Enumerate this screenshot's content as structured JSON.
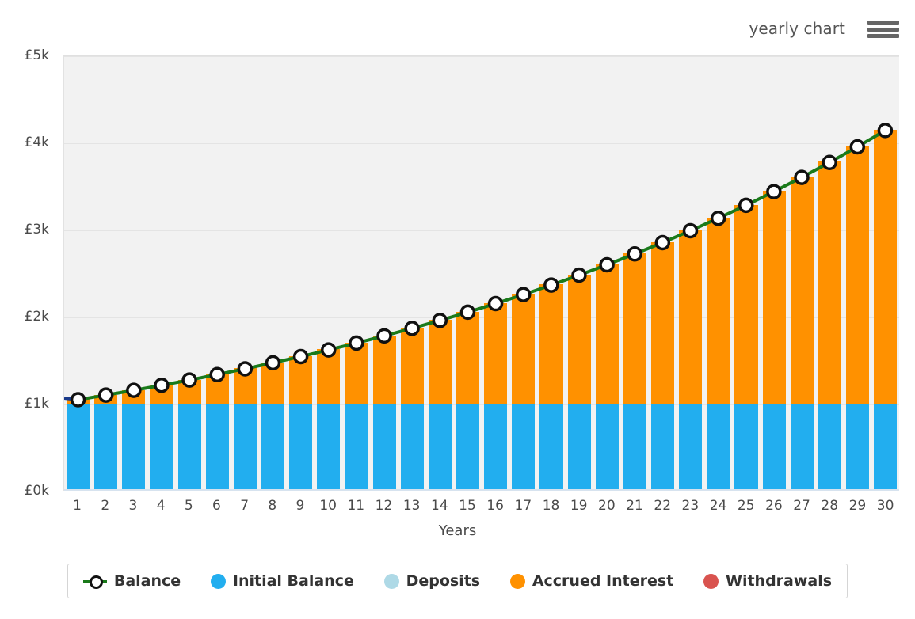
{
  "header": {
    "title": "yearly chart",
    "menu_icon": "hamburger-menu-icon"
  },
  "colors": {
    "initial_balance": "#22aeef",
    "deposits": "#aed9e6",
    "accrued_interest": "#ff9100",
    "withdrawals": "#d9534f",
    "balance_line": "#1a7a1a",
    "plot_background": "#f2f2f2",
    "gridline": "#e4e4e4"
  },
  "legend": {
    "items": [
      {
        "label": "Balance",
        "marker": "line-with-point",
        "color": "#1a7a1a"
      },
      {
        "label": "Initial Balance",
        "marker": "dot",
        "color": "#22aeef"
      },
      {
        "label": "Deposits",
        "marker": "dot",
        "color": "#aed9e6"
      },
      {
        "label": "Accrued Interest",
        "marker": "dot",
        "color": "#ff9100"
      },
      {
        "label": "Withdrawals",
        "marker": "dot",
        "color": "#d9534f"
      }
    ]
  },
  "chart_data": {
    "type": "bar",
    "title": "yearly chart",
    "xlabel": "Years",
    "ylabel": "",
    "ylim": [
      0,
      5000
    ],
    "ytick_labels": [
      "£5k",
      "£4k",
      "£3k",
      "£2k",
      "£1k",
      "£0k"
    ],
    "ytick_values": [
      5000,
      4000,
      3000,
      2000,
      1000,
      0
    ],
    "grid": true,
    "legend_position": "bottom",
    "stacked": true,
    "currency_symbol": "£",
    "categories": [
      1,
      2,
      3,
      4,
      5,
      6,
      7,
      8,
      9,
      10,
      11,
      12,
      13,
      14,
      15,
      16,
      17,
      18,
      19,
      20,
      21,
      22,
      23,
      24,
      25,
      26,
      27,
      28,
      29,
      30
    ],
    "series": [
      {
        "name": "Initial Balance",
        "color": "#22aeef",
        "values": [
          1000,
          1000,
          1000,
          1000,
          1000,
          1000,
          1000,
          1000,
          1000,
          1000,
          1000,
          1000,
          1000,
          1000,
          1000,
          1000,
          1000,
          1000,
          1000,
          1000,
          1000,
          1000,
          1000,
          1000,
          1000,
          1000,
          1000,
          1000,
          1000,
          1000
        ]
      },
      {
        "name": "Deposits",
        "color": "#aed9e6",
        "values": [
          0,
          0,
          0,
          0,
          0,
          0,
          0,
          0,
          0,
          0,
          0,
          0,
          0,
          0,
          0,
          0,
          0,
          0,
          0,
          0,
          0,
          0,
          0,
          0,
          0,
          0,
          0,
          0,
          0,
          0
        ]
      },
      {
        "name": "Accrued Interest",
        "color": "#ff9100",
        "values": [
          51,
          104,
          159,
          217,
          277,
          340,
          406,
          475,
          547,
          623,
          702,
          785,
          871,
          962,
          1057,
          1156,
          1260,
          1369,
          1483,
          1602,
          1727,
          1857,
          1994,
          2137,
          2286,
          2443,
          2607,
          2778,
          2958,
          3146
        ]
      },
      {
        "name": "Withdrawals",
        "color": "#d9534f",
        "values": [
          0,
          0,
          0,
          0,
          0,
          0,
          0,
          0,
          0,
          0,
          0,
          0,
          0,
          0,
          0,
          0,
          0,
          0,
          0,
          0,
          0,
          0,
          0,
          0,
          0,
          0,
          0,
          0,
          0,
          0
        ]
      }
    ],
    "line_series": {
      "name": "Balance",
      "color": "#1a7a1a",
      "marker": "circle-white-black-edge",
      "values": [
        1051,
        1104,
        1159,
        1217,
        1277,
        1340,
        1406,
        1475,
        1547,
        1623,
        1702,
        1785,
        1871,
        1962,
        2057,
        2156,
        2260,
        2369,
        2483,
        2602,
        2727,
        2857,
        2994,
        3137,
        3286,
        3443,
        3607,
        3778,
        3958,
        4146
      ]
    }
  }
}
